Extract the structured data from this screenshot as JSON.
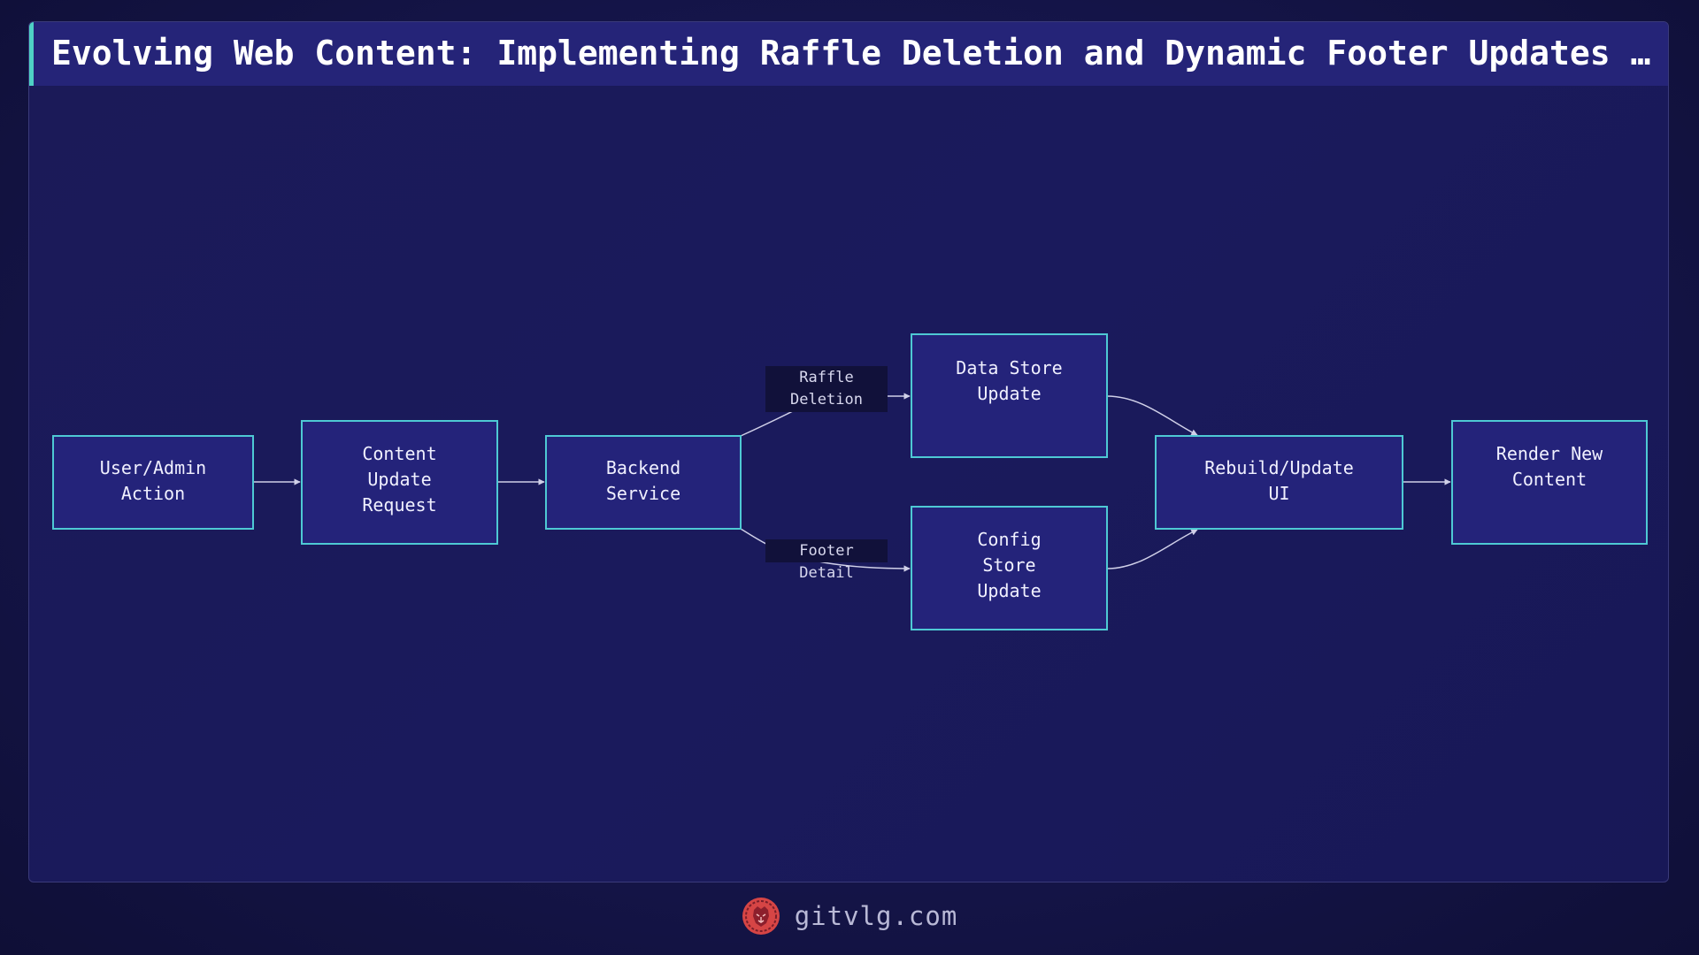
{
  "title": "Evolving Web Content: Implementing Raffle Deletion and Dynamic Footer Updates in Laravel",
  "nodes": {
    "user_admin_action": "User/Admin\nAction",
    "content_update_request": "Content\nUpdate\nRequest",
    "backend_service": "Backend\nService",
    "data_store_update": "Data Store\nUpdate",
    "config_store_update": "Config\nStore\nUpdate",
    "rebuild_update_ui": "Rebuild/Update\nUI",
    "render_new_content": "Render New\nContent"
  },
  "edges": {
    "raffle_deletion": "Raffle\nDeletion",
    "footer_detail": "Footer Detail"
  },
  "colors": {
    "accent": "#4fd1c5",
    "node_fill": "#24237a",
    "node_border": "#4ec9d4",
    "edge": "#d0d0e8"
  },
  "footer": {
    "logo_icon": "lion-head-icon",
    "site": "gitvlg.com"
  }
}
